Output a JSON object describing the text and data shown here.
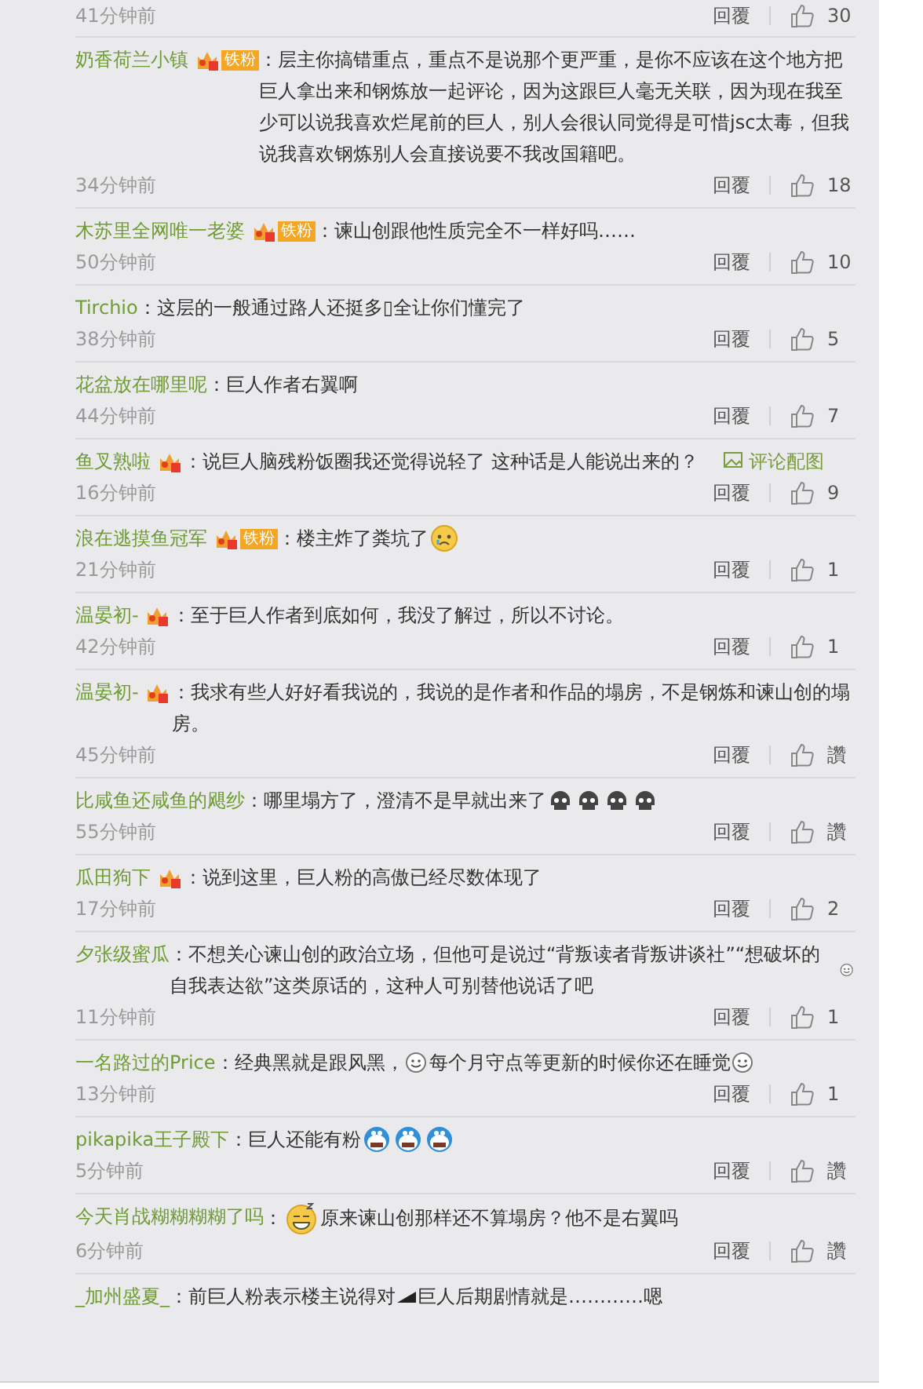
{
  "top_row": {
    "time": "41分钟前",
    "reply": "回覆",
    "likes": "30"
  },
  "comments": [
    {
      "user": "奶香荷兰小镇",
      "badge": true,
      "fan_tag": "铁粉",
      "parts": [
        {
          "kind": "text",
          "text": "：层主你搞错重点，重点不是说那个更严重，是你不应该在这个地方把巨人拿出来和钢炼放一起评论，因为这跟巨人毫无关联，因为现在我至少可以说我喜欢烂尾前的巨人，别人会很认同觉得是可惜jsc太毒，但我说我喜欢钢炼别人会直接说要不我改国籍吧。"
        }
      ],
      "time": "34分钟前",
      "reply": "回覆",
      "likes": "18"
    },
    {
      "user": "木苏里全网唯一老婆",
      "badge": true,
      "fan_tag": "铁粉",
      "parts": [
        {
          "kind": "text",
          "text": "：谏山创跟他性质完全不一样好吗……"
        }
      ],
      "time": "50分钟前",
      "reply": "回覆",
      "likes": "10"
    },
    {
      "user": "Tirchio",
      "badge": false,
      "parts": [
        {
          "kind": "text",
          "text": "：这层的一般通过路人还挺多▯全让你们懂完了"
        }
      ],
      "time": "38分钟前",
      "reply": "回覆",
      "likes": "5"
    },
    {
      "user": "花盆放在哪里呢",
      "badge": false,
      "parts": [
        {
          "kind": "text",
          "text": "：巨人作者右翼啊"
        }
      ],
      "time": "44分钟前",
      "reply": "回覆",
      "likes": "7"
    },
    {
      "user": "鱼叉熟啦",
      "badge": true,
      "parts": [
        {
          "kind": "text",
          "text": "：说巨人脑残粉饭圈我还觉得说轻了 这种话是人能说出来的？"
        }
      ],
      "image_link": "评论配图",
      "time": "16分钟前",
      "reply": "回覆",
      "likes": "9"
    },
    {
      "user": "浪在逃摸鱼冠军",
      "badge": true,
      "fan_tag": "铁粉",
      "parts": [
        {
          "kind": "text",
          "text": "：楼主炸了粪坑了"
        },
        {
          "kind": "cry"
        }
      ],
      "time": "21分钟前",
      "reply": "回覆",
      "likes": "1"
    },
    {
      "user": "温晏初-",
      "badge": true,
      "parts": [
        {
          "kind": "text",
          "text": "：至于巨人作者到底如何，我没了解过，所以不讨论。"
        }
      ],
      "time": "42分钟前",
      "reply": "回覆",
      "likes": "1"
    },
    {
      "user": "温晏初-",
      "badge": true,
      "parts": [
        {
          "kind": "text",
          "text": "：我求有些人好好看我说的，我说的是作者和作品的塌房，不是钢炼和谏山创的塌房。"
        }
      ],
      "time": "45分钟前",
      "reply": "回覆",
      "likes": "讚"
    },
    {
      "user": "比咸鱼还咸鱼的飓纱",
      "badge": false,
      "parts": [
        {
          "kind": "text",
          "text": "：哪里塌方了，澄清不是早就出来了"
        },
        {
          "kind": "skull"
        },
        {
          "kind": "skull"
        },
        {
          "kind": "skull"
        },
        {
          "kind": "skull"
        }
      ],
      "time": "55分钟前",
      "reply": "回覆",
      "likes": "讚"
    },
    {
      "user": "瓜田狗下",
      "badge": true,
      "parts": [
        {
          "kind": "text",
          "text": "：说到这里，巨人粉的高傲已经尽数体现了"
        }
      ],
      "time": "17分钟前",
      "reply": "回覆",
      "likes": "2"
    },
    {
      "user": "夕张级蜜瓜",
      "badge": false,
      "parts": [
        {
          "kind": "text",
          "text": "：不想关心谏山创的政治立场，但他可是说过“背叛读者背叛讲谈社”“想破坏的自我表达欲”这类原话的，这种人可别替他说话了吧"
        },
        {
          "kind": "smile"
        }
      ],
      "time": "11分钟前",
      "reply": "回覆",
      "likes": "1"
    },
    {
      "user": "一名路过的Price",
      "badge": false,
      "parts": [
        {
          "kind": "text",
          "text": "：经典黑就是跟风黑，"
        },
        {
          "kind": "smile"
        },
        {
          "kind": "text",
          "text": "每个月守点等更新的时候你还在睡觉"
        },
        {
          "kind": "smile"
        }
      ],
      "time": "13分钟前",
      "reply": "回覆",
      "likes": "1"
    },
    {
      "user": "pikapika王子殿下",
      "badge": false,
      "parts": [
        {
          "kind": "text",
          "text": "：巨人还能有粉"
        },
        {
          "kind": "cartoon"
        },
        {
          "kind": "cartoon"
        },
        {
          "kind": "cartoon"
        }
      ],
      "time": "5分钟前",
      "reply": "回覆",
      "likes": "讚"
    },
    {
      "user": "今天肖战糊糊糊糊了吗",
      "badge": false,
      "parts": [
        {
          "kind": "text",
          "text": "："
        },
        {
          "kind": "grin"
        },
        {
          "kind": "text",
          "text": "原来谏山创那样还不算塌房？他不是右翼吗"
        }
      ],
      "time": "6分钟前",
      "reply": "回覆",
      "likes": "讚"
    },
    {
      "user": "_加州盛夏_",
      "badge": false,
      "parts": [
        {
          "kind": "text",
          "text": "：前巨人粉表示楼主说得对"
        },
        {
          "kind": "wedge"
        },
        {
          "kind": "text",
          "text": "巨人后期剧情就是…………嗯"
        }
      ]
    }
  ]
}
